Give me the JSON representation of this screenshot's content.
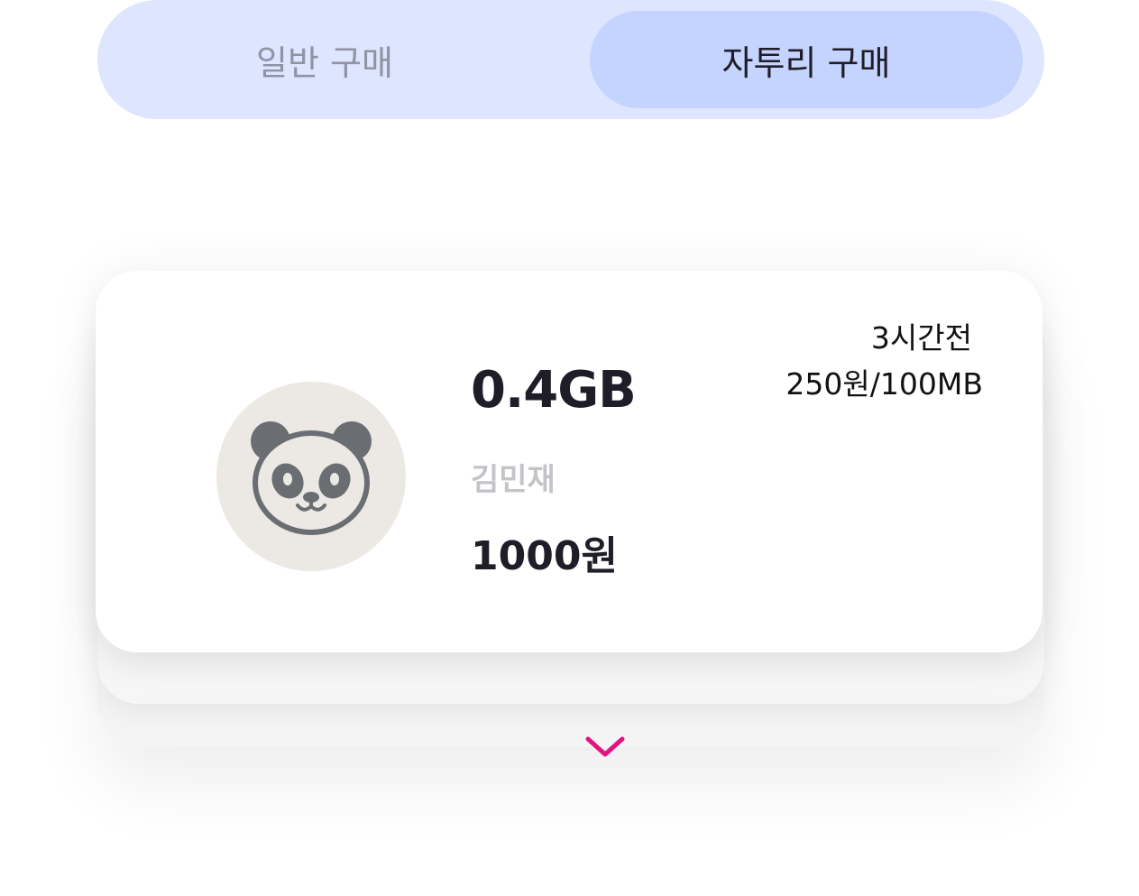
{
  "tabs": {
    "normal_label": "일반 구매",
    "leftover_label": "자투리 구매",
    "selected": "자투리 구매"
  },
  "listing": {
    "amount": "0.4GB",
    "seller": "김민재",
    "price": "1000원",
    "time_ago": "3시간전",
    "unit_price": "250원/100MB",
    "avatar_icon": "panda-icon"
  },
  "expand_icon": "chevron-down-icon",
  "colors": {
    "tab_track": "#dde5ff",
    "tab_selected": "#c4d4ff",
    "accent": "#e5137f",
    "avatar_bg": "#ece9e5",
    "panda": "#6a6e72"
  }
}
